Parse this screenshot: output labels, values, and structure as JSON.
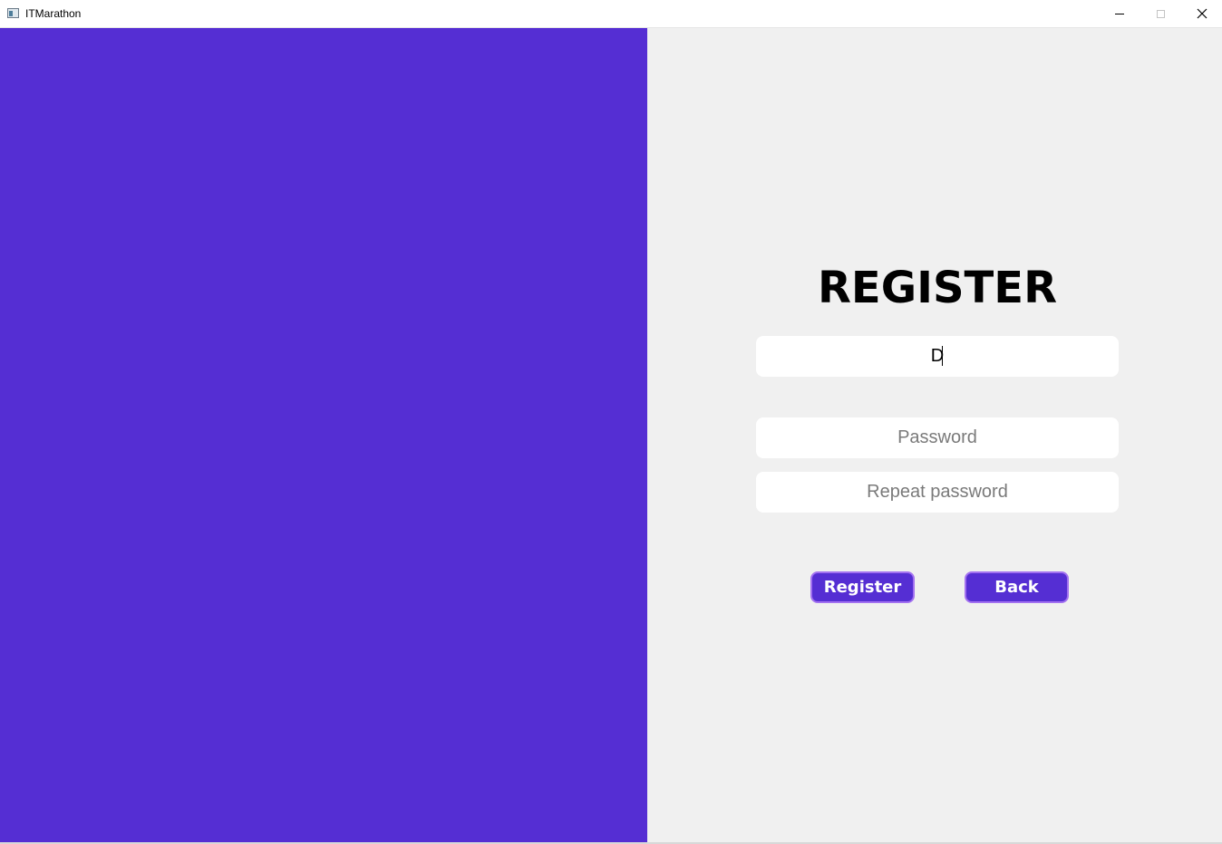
{
  "window": {
    "title": "ITMarathon",
    "icons": {
      "app": "app-window-icon",
      "minimize": "minimize-icon",
      "maximize": "maximize-icon",
      "close": "close-icon"
    },
    "close_glyph": "✕"
  },
  "colors": {
    "accent": "#552ed3",
    "accent_border": "#a271f0",
    "background": "#f0f0f0",
    "field": "#ffffff"
  },
  "form": {
    "heading": "REGISTER",
    "username": {
      "value": "D",
      "placeholder": ""
    },
    "password": {
      "value": "",
      "placeholder": "Password"
    },
    "repeat_password": {
      "value": "",
      "placeholder": "Repeat password"
    },
    "register_label": "Register",
    "back_label": "Back"
  }
}
